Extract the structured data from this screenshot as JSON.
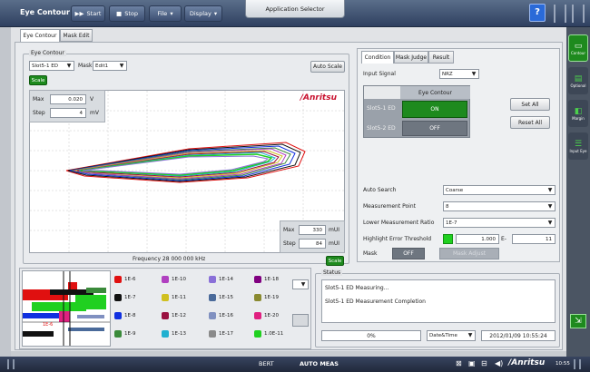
{
  "topbar": {
    "app_title": "Eye Contour",
    "start_label": "Start",
    "stop_label": "Stop",
    "file_label": "File",
    "display_label": "Display",
    "app_selector": "Application Selector"
  },
  "tabs": {
    "eye_contour": "Eye Contour",
    "mask_edit": "Mask Edit"
  },
  "eye": {
    "group_title": "Eye Contour",
    "slot_value": "Slot5-1 ED",
    "mask_label": "Mask",
    "mask_value": "Edit1",
    "auto_scale": "Auto Scale",
    "scale": "Scale",
    "max_label": "Max",
    "max_value": "0.020",
    "max_unit": "V",
    "step_label": "Step",
    "step_value": "4",
    "step_unit": "mV",
    "brand": "/Anritsu",
    "x_max_label": "Max",
    "x_max_value": "330",
    "x_unit": "mUI",
    "x_step_label": "Step",
    "x_step_value": "84",
    "x_step_unit": "mUI",
    "scale2": "Scale",
    "frequency": "Frequency 28 000 000 kHz"
  },
  "condition": {
    "tabs": [
      "Condition",
      "Mask Judge",
      "Result"
    ],
    "input_signal_label": "Input Signal",
    "input_signal_value": "NRZ",
    "eye_contour_header": "Eye Contour",
    "slot1_label": "Slot5-1 ED",
    "slot1_state": "ON",
    "slot2_label": "Slot5-2 ED",
    "slot2_state": "OFF",
    "set_all": "Set All",
    "reset_all": "Reset All",
    "auto_search_label": "Auto Search",
    "auto_search_value": "Coarse",
    "meas_point_label": "Measurement Point",
    "meas_point_value": "8",
    "lower_ratio_label": "Lower Measurement Ratio",
    "lower_ratio_value": "1E-7",
    "highlight_label": "Highlight Error Threshold",
    "highlight_mantissa": "1.000",
    "highlight_sep": "E-",
    "highlight_exp": "11",
    "mask_label": "Mask",
    "mask_state": "OFF",
    "mask_adjust": "Mask Adjust"
  },
  "legend": [
    {
      "label": "1E-6",
      "color": "#e01010"
    },
    {
      "label": "1E-10",
      "color": "#b040c0"
    },
    {
      "label": "1E-14",
      "color": "#8a70d8"
    },
    {
      "label": "1E-18",
      "color": "#800080"
    },
    {
      "label": "1E-7",
      "color": "#111111"
    },
    {
      "label": "1E-11",
      "color": "#d0c020"
    },
    {
      "label": "1E-15",
      "color": "#4a6a9a"
    },
    {
      "label": "1E-19",
      "color": "#8a8a30"
    },
    {
      "label": "1E-8",
      "color": "#1030e0"
    },
    {
      "label": "1E-12",
      "color": "#9a1040"
    },
    {
      "label": "1E-16",
      "color": "#8090c0"
    },
    {
      "label": "1E-20",
      "color": "#e02080"
    },
    {
      "label": "1E-9",
      "color": "#3a8a3a"
    },
    {
      "label": "1E-13",
      "color": "#20b0d0"
    },
    {
      "label": "1E-17",
      "color": "#8a8a8a"
    },
    {
      "label": "1.0E-11",
      "color": "#20d020"
    }
  ],
  "heatmap_marker": "1E-6",
  "status": {
    "title": "Status",
    "lines": [
      "Slot5-1 ED Measuring...",
      "Slot5-1 ED Measurement Completion"
    ],
    "progress": "0%",
    "progress_fraction": 0,
    "datetime_label": "Date&Time",
    "datetime_value": "2012/01/09 10:55:24"
  },
  "bottombar": {
    "bert": "BERT",
    "auto_meas": "AUTO MEAS",
    "brand": "/Anritsu",
    "clock": "10:55"
  },
  "sidebar": [
    "Contour",
    "Optional",
    "Margin",
    "Input Eye"
  ]
}
